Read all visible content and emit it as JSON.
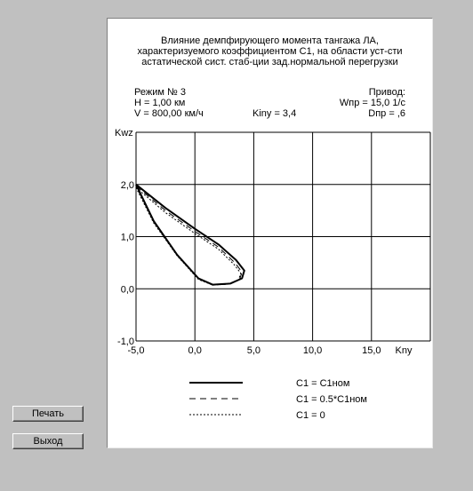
{
  "chart_data": {
    "type": "line",
    "title_lines": [
      "Влияние демпфирующего момента тангажа ЛА,",
      "характеризуемого коэффициентом С1, на области уст-сти",
      "астатической сист. стаб-ции зад.нормальной перегрузки"
    ],
    "mode": "Режим № 3",
    "h": "Н = 1,00 км",
    "v": "V = 800,00 км/ч",
    "kny_param": "Kiny = 3,4",
    "drive_title": "Привод:",
    "wpr": "Wпр = 15,0  1/с",
    "dpr": "Dпр = ,6",
    "xlabel": "Kny",
    "ylabel": "Kwz",
    "xlim": [
      -5,
      20
    ],
    "ylim": [
      -1,
      3
    ],
    "x_ticks": [
      -5,
      0,
      5,
      10,
      15
    ],
    "x_tick_labels": [
      "-5,0",
      "0,0",
      "5,0",
      "10,0",
      "15,0"
    ],
    "y_ticks": [
      -1,
      0,
      1,
      2
    ],
    "y_tick_labels": [
      "-1,0",
      "0,0",
      "1,0",
      "2,0"
    ],
    "grid": true,
    "series": [
      {
        "name": "С1 = С1ном",
        "style": "solid",
        "points": [
          [
            -5.0,
            2.0
          ],
          [
            -2.5,
            1.55
          ],
          [
            0,
            1.15
          ],
          [
            2.0,
            0.85
          ],
          [
            3.5,
            0.55
          ],
          [
            4.2,
            0.35
          ],
          [
            4.0,
            0.2
          ],
          [
            3.0,
            0.1
          ],
          [
            1.5,
            0.08
          ],
          [
            0.3,
            0.2
          ],
          [
            -1.5,
            0.65
          ],
          [
            -3.5,
            1.3
          ],
          [
            -5.0,
            2.0
          ]
        ]
      },
      {
        "name": "С1 = 0.5*С1ном",
        "style": "dashed",
        "points": [
          [
            -5.0,
            1.97
          ],
          [
            -2.5,
            1.5
          ],
          [
            0,
            1.1
          ],
          [
            2.0,
            0.8
          ],
          [
            3.4,
            0.5
          ],
          [
            4.0,
            0.32
          ],
          [
            3.8,
            0.18
          ],
          [
            2.9,
            0.09
          ],
          [
            1.5,
            0.07
          ],
          [
            0.3,
            0.19
          ],
          [
            -1.5,
            0.64
          ],
          [
            -3.5,
            1.28
          ],
          [
            -5.0,
            1.97
          ]
        ]
      },
      {
        "name": "С1 = 0",
        "style": "dotted",
        "points": [
          [
            -5.0,
            1.94
          ],
          [
            -2.5,
            1.46
          ],
          [
            0,
            1.06
          ],
          [
            2.0,
            0.76
          ],
          [
            3.3,
            0.47
          ],
          [
            3.9,
            0.3
          ],
          [
            3.7,
            0.17
          ],
          [
            2.8,
            0.09
          ],
          [
            1.5,
            0.07
          ],
          [
            0.3,
            0.18
          ],
          [
            -1.5,
            0.63
          ],
          [
            -3.5,
            1.26
          ],
          [
            -5.0,
            1.94
          ]
        ]
      }
    ]
  },
  "buttons": {
    "print": "Печать",
    "exit": "Выход"
  }
}
